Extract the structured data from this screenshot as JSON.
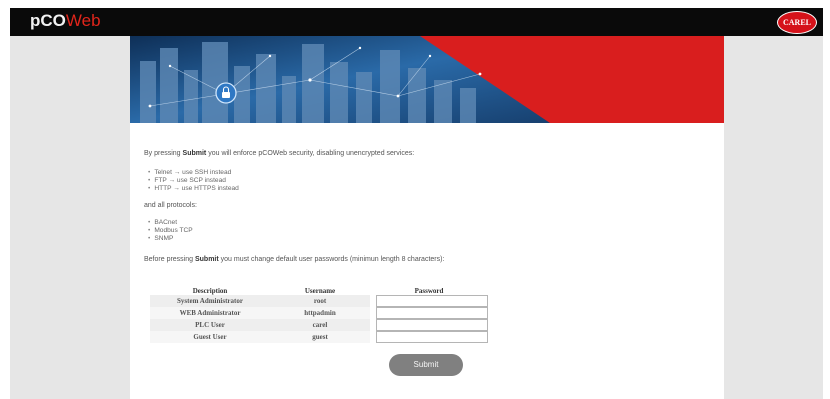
{
  "header": {
    "logo_part1": "pCO",
    "logo_part2": "Web",
    "brand_badge": "CAREL"
  },
  "intro": {
    "line1_pre": "By pressing ",
    "line1_bold": "Submit",
    "line1_post": " you will enforce pCOWeb security, disabling unencrypted services:"
  },
  "services": [
    "Telnet → use SSH instead",
    "FTP → use SCP instead",
    "HTTP → use HTTPS instead"
  ],
  "protocols_label": "and all protocols:",
  "protocols": [
    "BACnet",
    "Modbus TCP",
    "SNMP"
  ],
  "passwords_note": {
    "pre": "Before pressing ",
    "bold": "Submit",
    "post": " you must change default user passwords (minimun length 8 characters):"
  },
  "table": {
    "headers": [
      "Description",
      "Username",
      "Password"
    ],
    "rows": [
      {
        "description": "System Administrator",
        "username": "root"
      },
      {
        "description": "WEB Administrator",
        "username": "httpadmin"
      },
      {
        "description": "PLC User",
        "username": "carel"
      },
      {
        "description": "Guest User",
        "username": "guest"
      }
    ]
  },
  "submit_label": "Submit",
  "colors": {
    "topbar": "#0a0a0a",
    "brand_red": "#e1251b",
    "button": "#808080",
    "banner_blue": "#1f4f86"
  },
  "icons": {
    "banner_center": "lock-icon"
  }
}
